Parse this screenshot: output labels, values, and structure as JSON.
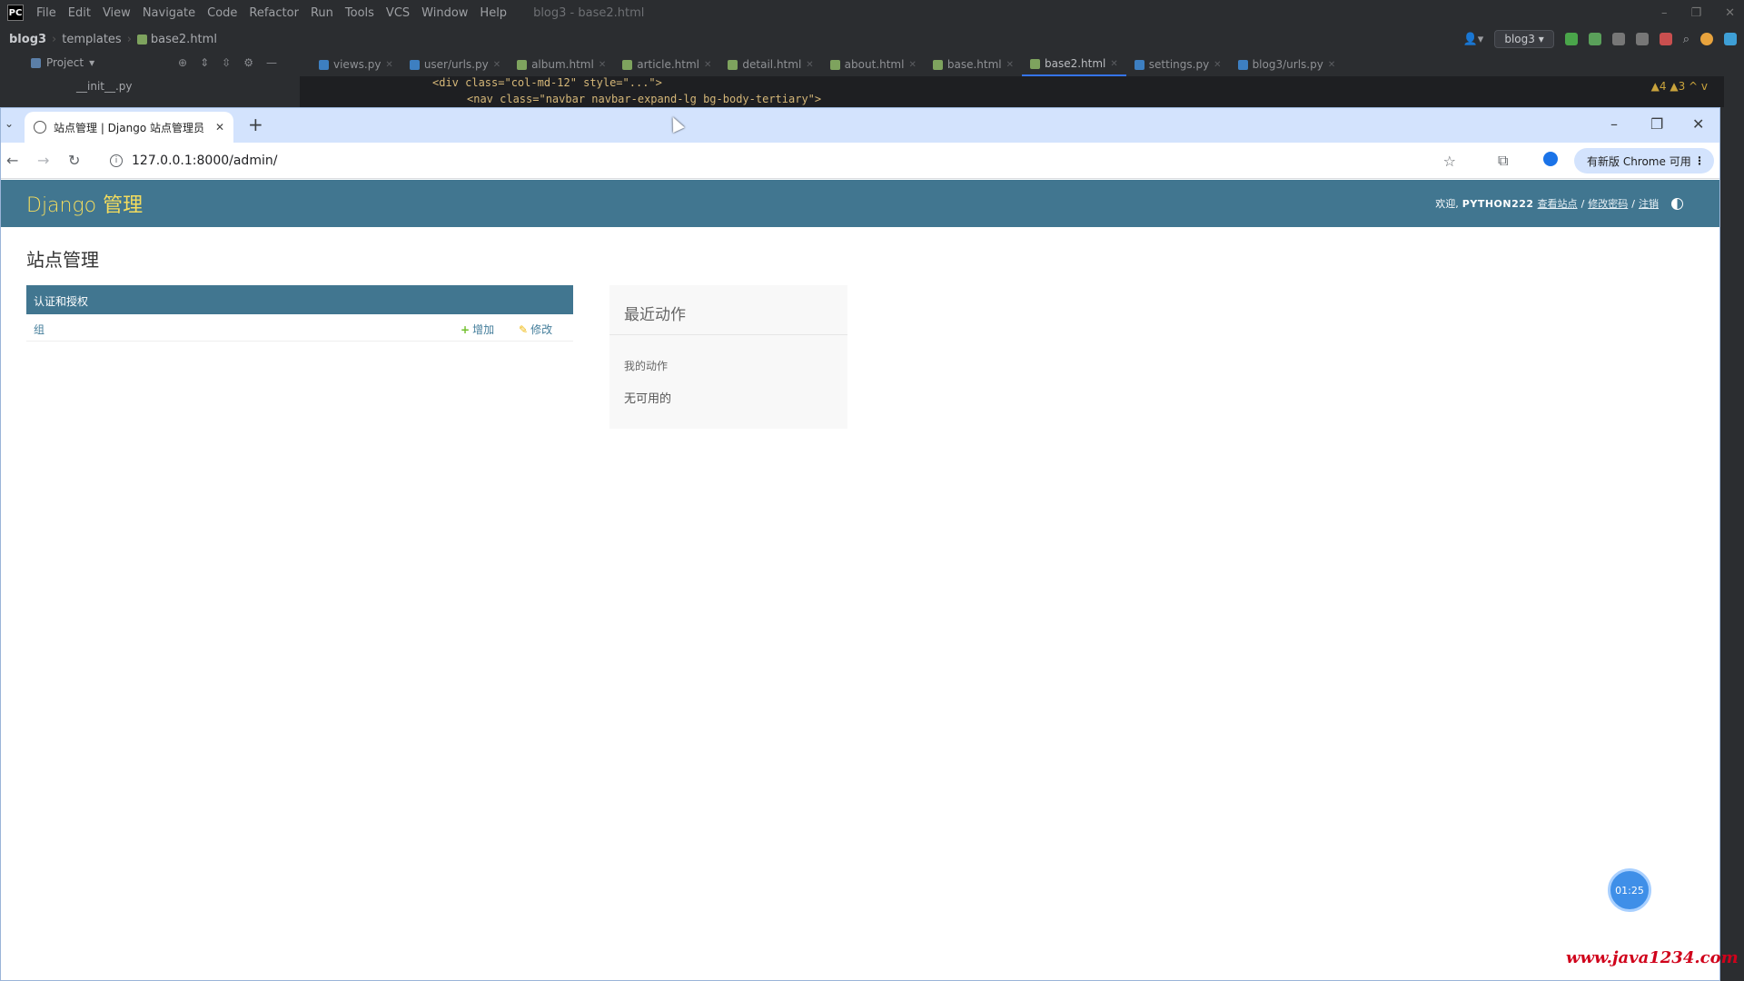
{
  "ide": {
    "menu": [
      "File",
      "Edit",
      "View",
      "Navigate",
      "Code",
      "Refactor",
      "Run",
      "Tools",
      "VCS",
      "Window",
      "Help"
    ],
    "title": "blog3 - base2.html",
    "breadcrumb": {
      "project": "blog3",
      "folder": "templates",
      "file": "base2.html"
    },
    "run_config": "blog3",
    "project_label": "Project",
    "tabs": [
      {
        "label": "views.py",
        "type": "py"
      },
      {
        "label": "user/urls.py",
        "type": "py"
      },
      {
        "label": "album.html",
        "type": "html"
      },
      {
        "label": "article.html",
        "type": "html"
      },
      {
        "label": "detail.html",
        "type": "html"
      },
      {
        "label": "about.html",
        "type": "html"
      },
      {
        "label": "base.html",
        "type": "html"
      },
      {
        "label": "base2.html",
        "type": "html",
        "active": true
      },
      {
        "label": "settings.py",
        "type": "py"
      },
      {
        "label": "blog3/urls.py",
        "type": "py"
      }
    ],
    "tree_node": "__init__.py",
    "code_line1": "<div class=\"col-md-12\" style=\"...\">",
    "code_line2": "<nav class=\"navbar navbar-expand-lg bg-body-tertiary\">",
    "warnings": "▲4  ▲3  ^  v"
  },
  "browser": {
    "tab_title": "站点管理 | Django 站点管理员",
    "url": "127.0.0.1:8000/admin/",
    "update_button": "有新版 Chrome 可用"
  },
  "admin": {
    "branding": "Django 管理",
    "welcome": "欢迎,",
    "username": "PYTHON222",
    "view_site": "查看站点",
    "change_password": "修改密码",
    "logout": "注销",
    "page_title": "站点管理",
    "app_caption": "认证和授权",
    "model_name": "组",
    "add_label": "增加",
    "change_label": "修改",
    "recent_actions_title": "最近动作",
    "my_actions": "我的动作",
    "none_available": "无可用的"
  },
  "timer": "01:25",
  "watermark": "www.java1234.com"
}
